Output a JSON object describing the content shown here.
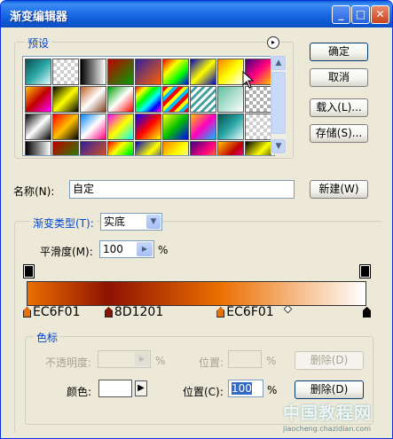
{
  "window": {
    "title": "渐变编辑器",
    "minimize_glyph": "_",
    "maximize_glyph": "□",
    "close_glyph": "✕"
  },
  "presets": {
    "label": "预设",
    "menu_glyph": "▸",
    "swatches": [
      "linear-gradient(135deg,#0a5050,#2aa6a6,#e8fbfb)",
      "repeating-conic-gradient(#cfcfcf 0 25%,#ffffff 0 50%) 0 0/8px 8px",
      "linear-gradient(90deg,#000000,#ffffff)",
      "linear-gradient(135deg,#c00000,#00a000)",
      "linear-gradient(135deg,#3020a0,#ff6000)",
      "linear-gradient(135deg,#ff0000,#ffff00,#00ff00,#0000ff)",
      "linear-gradient(135deg,#0000c0,#ffff00,#0000c0)",
      "linear-gradient(135deg,#ff8000,#ffff00,#ffffff)",
      "linear-gradient(135deg,#400080,#ff0080,#ffc000)",
      "linear-gradient(135deg,#ffc000,#c00000,#ff00ff)",
      "linear-gradient(135deg,#000000,#ffff00,#000000)",
      "linear-gradient(135deg,#c06020,#ffffff,#804020)",
      "linear-gradient(135deg,#00a000,#ffffff,#ff0000)",
      "linear-gradient(135deg,#ff0000,#ffff00,#00ff00,#00ffff,#0000ff,#ff00ff)",
      "repeating-linear-gradient(135deg,#ff0000 0 4px,#ffff00 4px 8px,#00c0ff 8px 12px)",
      "repeating-linear-gradient(135deg,#ffffff 0 3px,#40a0a0 3px 6px)",
      "linear-gradient(135deg,#60c0a0,#ffffff)",
      "repeating-conic-gradient(#b0b0b0 0 25%,#ffffff 0 50%) 0 0/8px 8px",
      "linear-gradient(135deg,#000000,#ffffff,#000000)",
      "linear-gradient(135deg,#ff0000,#ffc000,#000000)",
      "linear-gradient(135deg,#0080ff,#ffffff,#ff0080)",
      "linear-gradient(135deg,#ff00ff,#ffff00,#00ffff)",
      "linear-gradient(135deg,#0000ff,#ff0000,#ffff00)",
      "linear-gradient(135deg,#ffff00,#00c000,#0000ff)",
      "linear-gradient(135deg,#ffc000,#ff00c0,#00c0ff)"
    ]
  },
  "buttons": {
    "ok": "确定",
    "cancel": "取消",
    "load": "载入(L)...",
    "save": "存储(S)...",
    "new": "新建(W)"
  },
  "name_field": {
    "label": "名称(N):",
    "value": "自定"
  },
  "gradient_type": {
    "label": "渐变类型(T):",
    "value": "实底"
  },
  "smoothness": {
    "label": "平滑度(M):",
    "value": "100",
    "unit": "%"
  },
  "gradient": {
    "css": "linear-gradient(90deg,#EC6F01 0%,#8D1201 24%,#EC6F01 57%,#ffffff 100%)",
    "stops": [
      {
        "color": "#EC6F01",
        "label": "EC6F01",
        "location_pct": 0
      },
      {
        "color": "#8D1201",
        "label": "8D1201",
        "location_pct": 24
      },
      {
        "color": "#EC6F01",
        "label": "EC6F01",
        "location_pct": 57
      },
      {
        "color": "#ffffff",
        "label": "",
        "location_pct": 100
      }
    ]
  },
  "color_stops": {
    "label": "色标",
    "opacity_label": "不透明度:",
    "opacity_unit": "%",
    "opacity_location_label": "位置:",
    "opacity_location_unit": "%",
    "opacity_delete": "删除(D)",
    "color_label": "颜色:",
    "color_arrow_glyph": "▶",
    "location_label": "位置(C):",
    "location_value": "100",
    "location_unit": "%",
    "delete": "删除(D)"
  },
  "watermark": {
    "text1": "中国教程网",
    "text2": "jiaocheng.chazidian.com"
  }
}
